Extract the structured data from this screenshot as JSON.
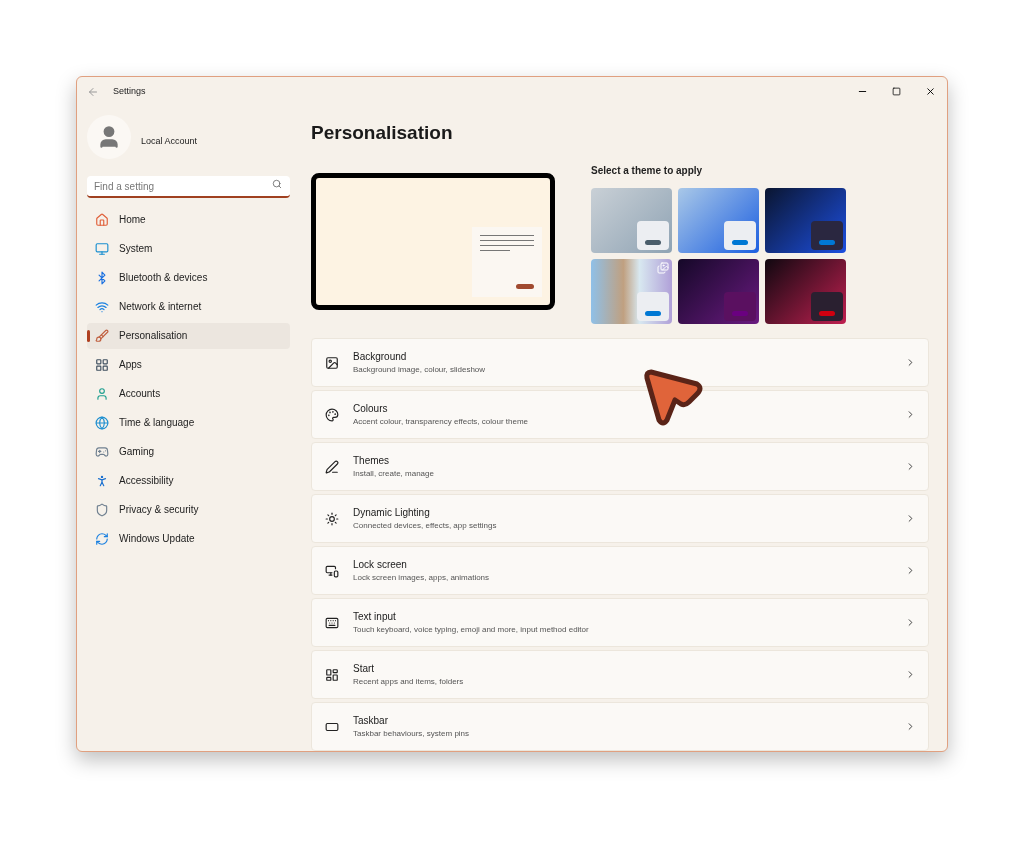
{
  "window": {
    "title": "Settings"
  },
  "account": {
    "name": "Local Account"
  },
  "search": {
    "placeholder": "Find a setting"
  },
  "nav": [
    {
      "label": "Home",
      "selected": false
    },
    {
      "label": "System",
      "selected": false
    },
    {
      "label": "Bluetooth & devices",
      "selected": false
    },
    {
      "label": "Network & internet",
      "selected": false
    },
    {
      "label": "Personalisation",
      "selected": true
    },
    {
      "label": "Apps",
      "selected": false
    },
    {
      "label": "Accounts",
      "selected": false
    },
    {
      "label": "Time & language",
      "selected": false
    },
    {
      "label": "Gaming",
      "selected": false
    },
    {
      "label": "Accessibility",
      "selected": false
    },
    {
      "label": "Privacy & security",
      "selected": false
    },
    {
      "label": "Windows Update",
      "selected": false
    }
  ],
  "page_title": "Personalisation",
  "themes_heading": "Select a theme to apply",
  "themes": [
    {
      "color": "#4a5d6b",
      "slideshow": false
    },
    {
      "color": "#0078d4",
      "slideshow": false
    },
    {
      "color": "#0078d4",
      "slideshow": false
    },
    {
      "color": "#0078d4",
      "slideshow": true
    },
    {
      "color": "#6a0080",
      "slideshow": false
    },
    {
      "color": "#d00010",
      "slideshow": false
    }
  ],
  "settings": [
    {
      "title": "Background",
      "subtitle": "Background image, colour, slideshow"
    },
    {
      "title": "Colours",
      "subtitle": "Accent colour, transparency effects, colour theme"
    },
    {
      "title": "Themes",
      "subtitle": "Install, create, manage"
    },
    {
      "title": "Dynamic Lighting",
      "subtitle": "Connected devices, effects, app settings"
    },
    {
      "title": "Lock screen",
      "subtitle": "Lock screen images, apps, animations"
    },
    {
      "title": "Text input",
      "subtitle": "Touch keyboard, voice typing, emoji and more, input method editor"
    },
    {
      "title": "Start",
      "subtitle": "Recent apps and items, folders"
    },
    {
      "title": "Taskbar",
      "subtitle": "Taskbar behaviours, system pins"
    }
  ]
}
